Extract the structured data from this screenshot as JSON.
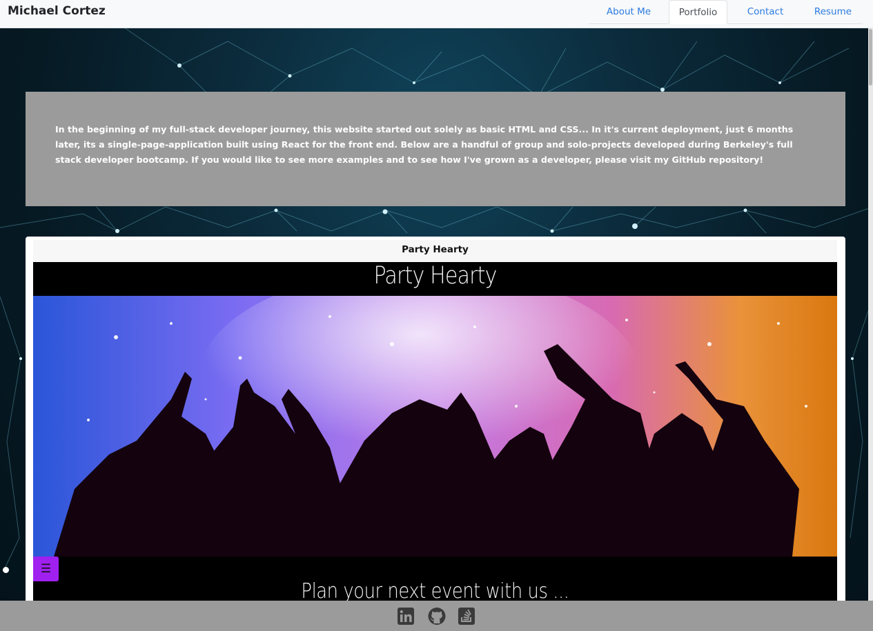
{
  "header": {
    "brand": "Michael Cortez",
    "tabs": [
      {
        "label": "About Me",
        "active": false
      },
      {
        "label": "Portfolio",
        "active": true
      },
      {
        "label": "Contact",
        "active": false
      },
      {
        "label": "Resume",
        "active": false
      }
    ]
  },
  "intro": {
    "text": "In the beginning of my full-stack developer journey, this website started out solely as basic HTML and CSS... In it's current deployment, just 6 months later, its a single-page-application built using React for the front end. Below are a handful of group and solo-projects developed during Berkeley's full stack developer bootcamp. If you would like to see more examples and to see how I've grown as a developer, please visit my GitHub repository!"
  },
  "project": {
    "card_title": "Party Hearty",
    "screenshot_title": "Party Hearty",
    "tagline": "Plan your next event with us ...",
    "menu_icon": "hamburger-icon",
    "menu_glyph": "☰"
  },
  "footer": {
    "icons": [
      "linkedin-icon",
      "github-icon",
      "stackoverflow-icon"
    ]
  },
  "colors": {
    "accent_link": "#2a7ae2",
    "panel_gray": "#9b9b9b",
    "menu_purple": "#a020f0"
  }
}
